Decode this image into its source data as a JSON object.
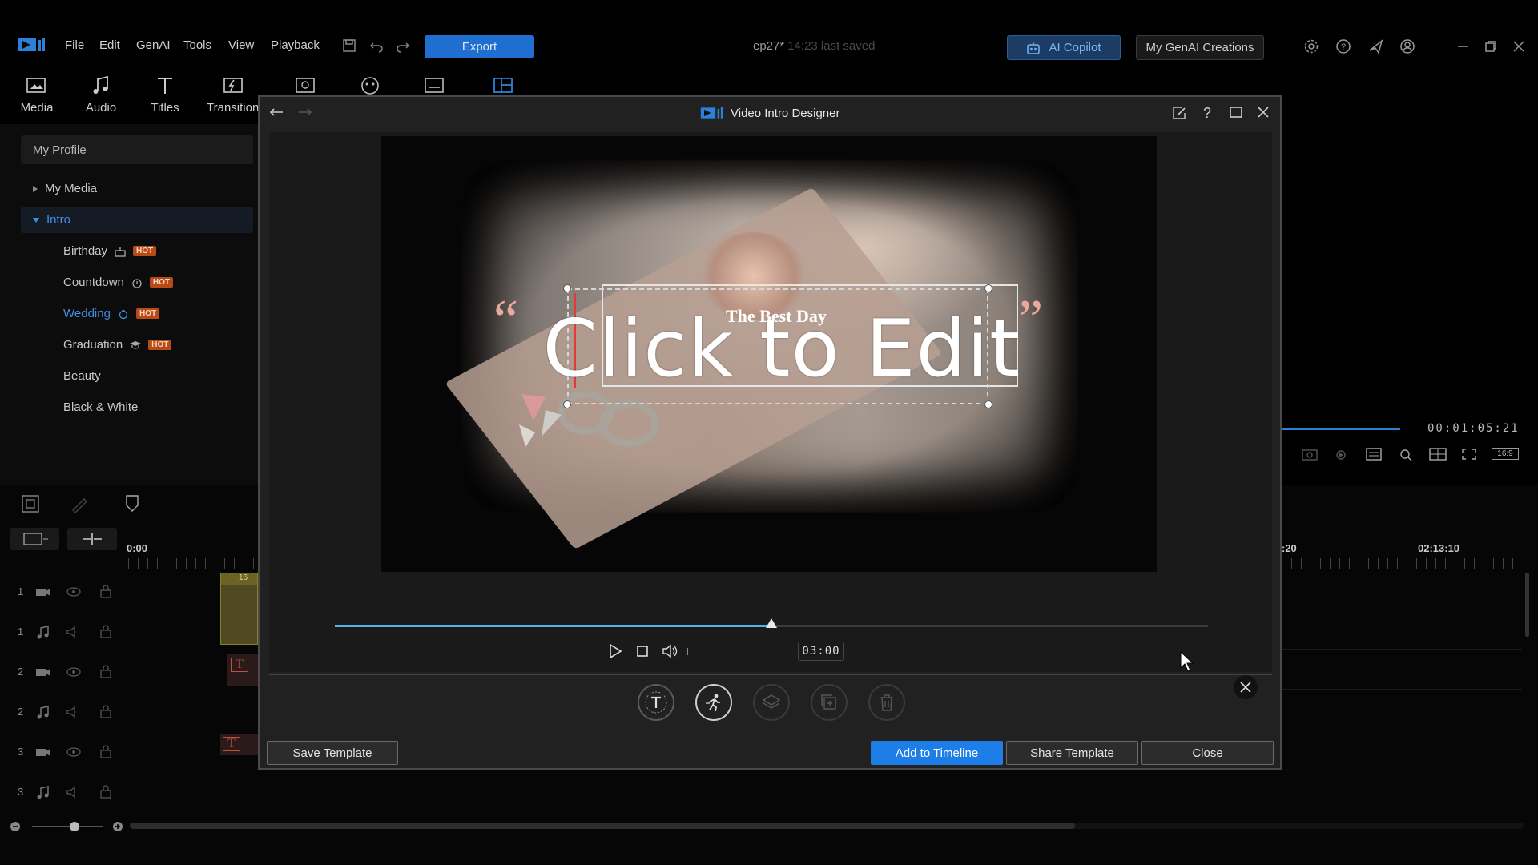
{
  "menubar": {
    "items": [
      "File",
      "Edit",
      "GenAI",
      "Tools",
      "View",
      "Playback"
    ],
    "export_label": "Export",
    "project_name": "ep27*",
    "saved_text": "14:23 last saved",
    "copilot_label": "AI Copilot",
    "genai_creations_label": "My GenAI Creations"
  },
  "library_tabs": [
    "Media",
    "Audio",
    "Titles",
    "Transition"
  ],
  "left_panel": {
    "profile": "My Profile",
    "my_media": "My Media",
    "intro": "Intro",
    "items": [
      {
        "label": "Birthday",
        "badge": "HOT"
      },
      {
        "label": "Countdown",
        "badge": "HOT"
      },
      {
        "label": "Wedding",
        "badge": "HOT"
      },
      {
        "label": "Graduation",
        "badge": "HOT"
      },
      {
        "label": "Beauty",
        "badge": ""
      },
      {
        "label": "Black & White",
        "badge": ""
      }
    ]
  },
  "right_preview": {
    "timecode": "00:01:05:21",
    "aspect": "16:9"
  },
  "timeline": {
    "start": "0:00",
    "mark1": ":20",
    "mark2": "02:13:10",
    "tracks": [
      "1",
      "1",
      "2",
      "2",
      "3",
      "3"
    ],
    "clip_label": "16"
  },
  "dialog": {
    "title": "Video Intro Designer",
    "subtitle_text": "The Best Day",
    "main_text": "Click to Edit",
    "time": "03:00",
    "progress": 0.5,
    "buttons": {
      "save_template": "Save Template",
      "add_to_timeline": "Add to Timeline",
      "share_template": "Share Template",
      "close": "Close"
    }
  },
  "colors": {
    "accent": "#1e7ee8",
    "hot_badge": "#b84a16",
    "scrub": "#4fb4ea"
  }
}
